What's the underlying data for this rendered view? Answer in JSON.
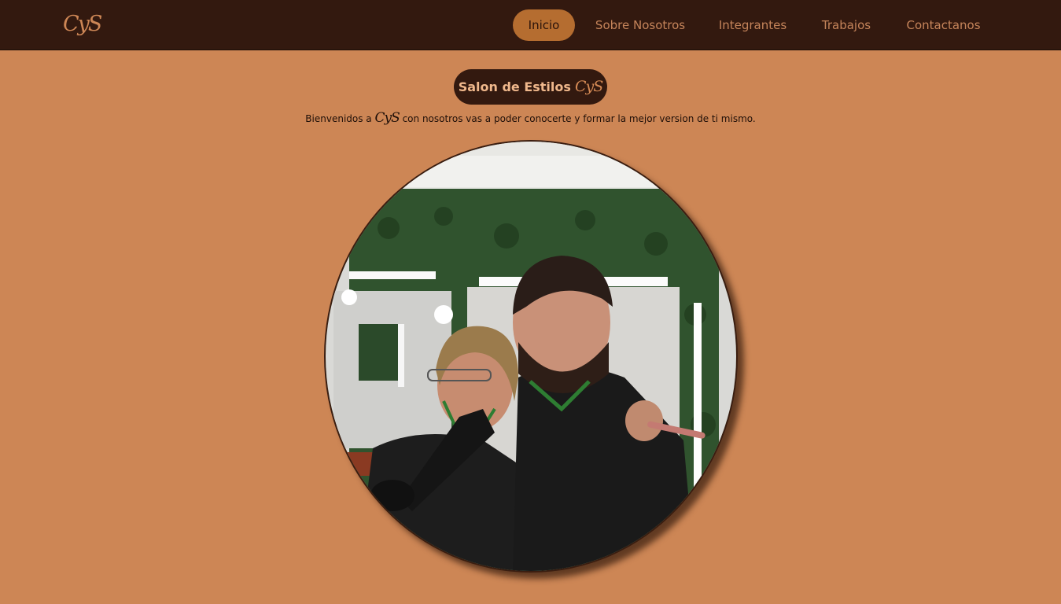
{
  "nav": {
    "logo": "CyS",
    "items": [
      {
        "label": "Inicio",
        "active": true
      },
      {
        "label": "Sobre Nosotros",
        "active": false
      },
      {
        "label": "Integrantes",
        "active": false
      },
      {
        "label": "Trabajos",
        "active": false
      },
      {
        "label": "Contactanos",
        "active": false
      }
    ]
  },
  "hero": {
    "title": "Salon de Estilos",
    "title_brand": "CyS",
    "subtitle_before": "Bienvenidos a",
    "subtitle_brand": "CyS",
    "subtitle_after": "con nosotros vas a poder conocerte y formar la mejor version de ti mismo."
  },
  "colors": {
    "page_background": "#cd8655",
    "navbar_background": "#33190f",
    "active_nav_background": "#b56d30",
    "title_pill_background": "#33190f"
  }
}
